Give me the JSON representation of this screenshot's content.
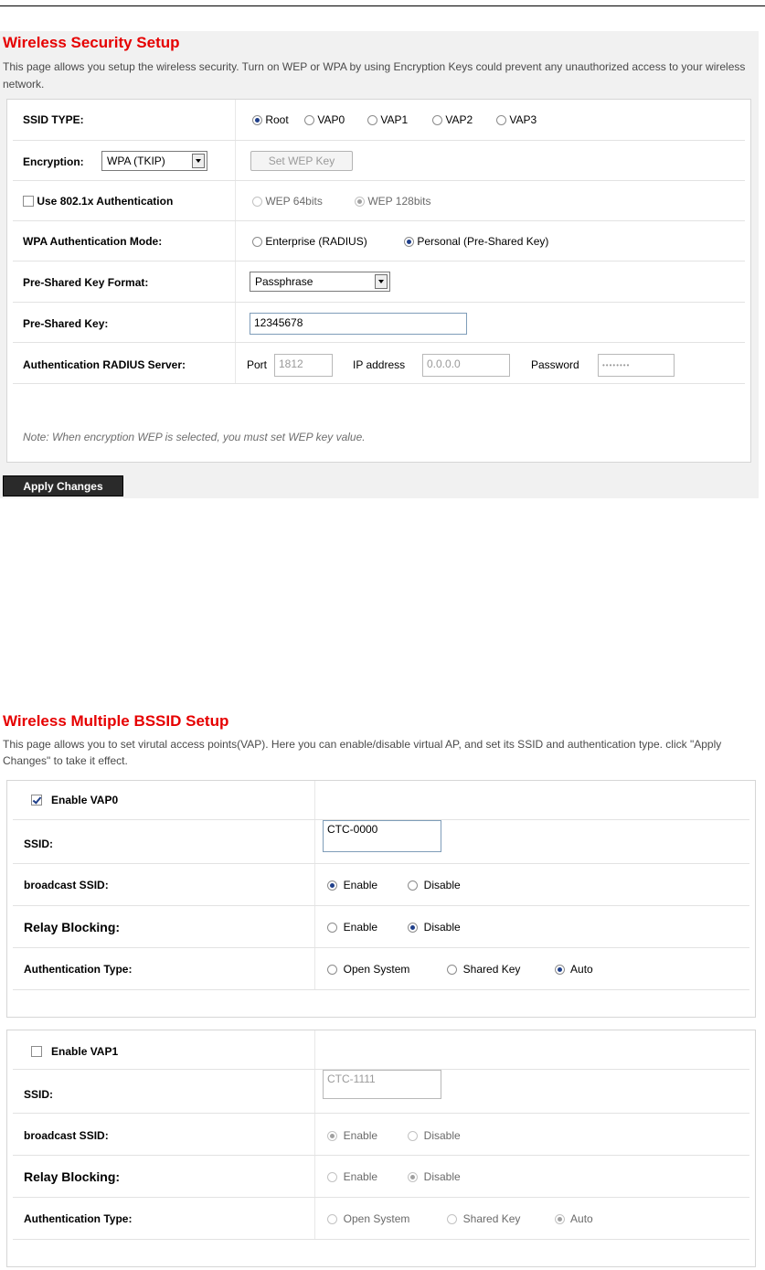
{
  "security": {
    "title": "Wireless Security Setup",
    "description": "This page allows you setup the wireless security. Turn on WEP or WPA by using Encryption Keys could prevent any unauthorized access to your wireless network.",
    "ssid_type_label": "SSID TYPE:",
    "ssid_options": [
      "Root",
      "VAP0",
      "VAP1",
      "VAP2",
      "VAP3"
    ],
    "ssid_selected": "Root",
    "encryption_label": "Encryption:",
    "encryption_value": "WPA (TKIP)",
    "set_wep_key_label": "Set WEP Key",
    "use_8021x_label": "Use 802.1x Authentication",
    "use_8021x_checked": false,
    "wep_options": [
      "WEP 64bits",
      "WEP 128bits"
    ],
    "wep_selected": "WEP 128bits",
    "wpa_mode_label": "WPA Authentication Mode:",
    "wpa_mode_options": [
      "Enterprise (RADIUS)",
      "Personal (Pre-Shared Key)"
    ],
    "wpa_mode_selected": "Personal (Pre-Shared Key)",
    "psk_format_label": "Pre-Shared Key Format:",
    "psk_format_value": "Passphrase",
    "psk_label": "Pre-Shared Key:",
    "psk_value": "12345678",
    "radius_label": "Authentication RADIUS Server:",
    "port_label": "Port",
    "port_value": "1812",
    "ip_label": "IP address",
    "ip_value": "0.0.0.0",
    "password_label": "Password",
    "password_value": "••••••••",
    "note": "Note: When encryption WEP is selected, you must set WEP key value.",
    "apply_label": "Apply Changes"
  },
  "bssid": {
    "title": "Wireless Multiple BSSID Setup",
    "description": "This page allows you to set virutal access points(VAP). Here you can enable/disable virtual AP, and set its SSID and authentication type. click \"Apply Changes\" to take it effect.",
    "vaps": [
      {
        "enable_label": "Enable VAP0",
        "enabled": true,
        "ssid_label": "SSID:",
        "ssid_value": "CTC-0000",
        "broadcast_label": "broadcast SSID:",
        "broadcast_options": [
          "Enable",
          "Disable"
        ],
        "broadcast_selected": "Enable",
        "relay_label": "Relay Blocking:",
        "relay_options": [
          "Enable",
          "Disable"
        ],
        "relay_selected": "Disable",
        "auth_label": "Authentication Type:",
        "auth_options": [
          "Open System",
          "Shared Key",
          "Auto"
        ],
        "auth_selected": "Auto"
      },
      {
        "enable_label": "Enable VAP1",
        "enabled": false,
        "ssid_label": "SSID:",
        "ssid_value": "CTC-1111",
        "broadcast_label": "broadcast SSID:",
        "broadcast_options": [
          "Enable",
          "Disable"
        ],
        "broadcast_selected": "Enable",
        "relay_label": "Relay Blocking:",
        "relay_options": [
          "Enable",
          "Disable"
        ],
        "relay_selected": "Disable",
        "auth_label": "Authentication Type:",
        "auth_options": [
          "Open System",
          "Shared Key",
          "Auto"
        ],
        "auth_selected": "Auto"
      }
    ]
  }
}
